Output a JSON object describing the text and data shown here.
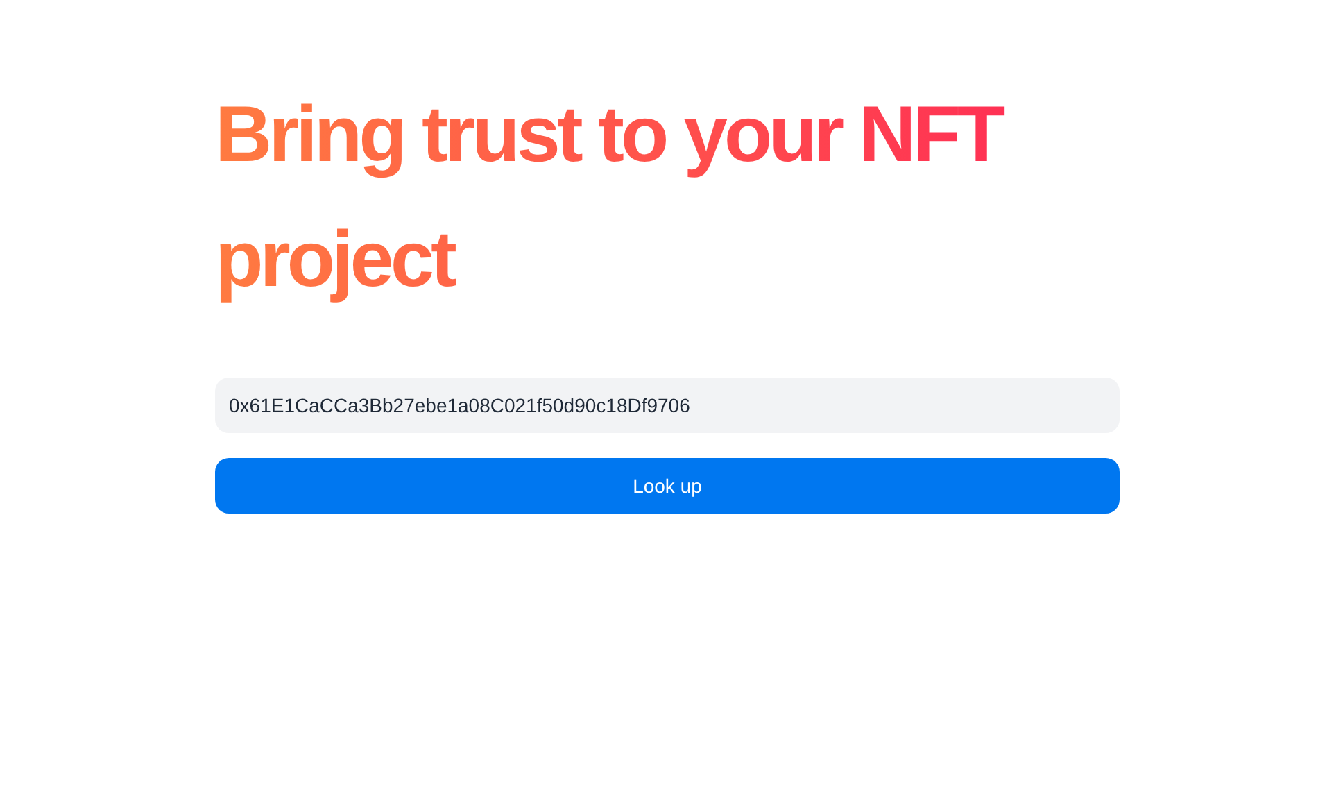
{
  "heading": "Bring trust to your NFT project",
  "address_field": {
    "value": "0x61E1CaCCa3Bb27ebe1a08C021f50d90c18Df9706"
  },
  "lookup_button": {
    "label": "Look up"
  }
}
